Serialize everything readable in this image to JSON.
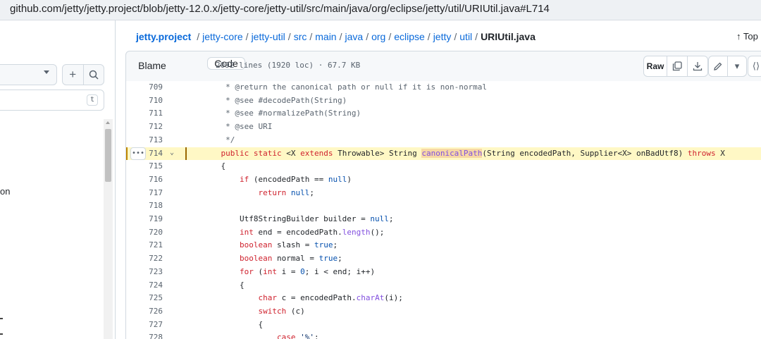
{
  "browser": {
    "url": "github.com/jetty/jetty.project/blob/jetty-12.0.x/jetty-core/jetty-util/src/main/java/org/eclipse/jetty/util/URIUtil.java#L714"
  },
  "sidebar": {
    "search_shortcut": "t",
    "partial_item": "on",
    "add_icon": "plus-icon",
    "search_icon": "search-icon"
  },
  "breadcrumb": {
    "root": "jetty.project",
    "segments": [
      "jetty-core",
      "jetty-util",
      "src",
      "main",
      "java",
      "org",
      "eclipse",
      "jetty",
      "util"
    ],
    "current": "URIUtil.java"
  },
  "header": {
    "top_label": "Top"
  },
  "toolbar": {
    "code_tab": "Code",
    "blame_tab": "Blame",
    "file_info": "2092 lines (1920 loc) · 67.7 KB",
    "raw_label": "Raw"
  },
  "highlighted_line": 714,
  "code_lines": [
    {
      "n": "709",
      "text": "     * @return the canonical path or null if it is non-normal"
    },
    {
      "n": "710",
      "text": "     * @see #decodePath(String)"
    },
    {
      "n": "711",
      "text": "     * @see #normalizePath(String)"
    },
    {
      "n": "712",
      "text": "     * @see URI"
    },
    {
      "n": "713",
      "text": "     */"
    },
    {
      "n": "714",
      "text": "    public static <X extends Throwable> String canonicalPath(String encodedPath, Supplier<X> onBadUtf8) throws X"
    },
    {
      "n": "715",
      "text": "    {"
    },
    {
      "n": "716",
      "text": "        if (encodedPath == null)"
    },
    {
      "n": "717",
      "text": "            return null;"
    },
    {
      "n": "718",
      "text": ""
    },
    {
      "n": "719",
      "text": "        Utf8StringBuilder builder = null;"
    },
    {
      "n": "720",
      "text": "        int end = encodedPath.length();"
    },
    {
      "n": "721",
      "text": "        boolean slash = true;"
    },
    {
      "n": "722",
      "text": "        boolean normal = true;"
    },
    {
      "n": "723",
      "text": "        for (int i = 0; i < end; i++)"
    },
    {
      "n": "724",
      "text": "        {"
    },
    {
      "n": "725",
      "text": "            char c = encodedPath.charAt(i);"
    },
    {
      "n": "726",
      "text": "            switch (c)"
    },
    {
      "n": "727",
      "text": "            {"
    },
    {
      "n": "728",
      "text": "                case '%':"
    }
  ]
}
